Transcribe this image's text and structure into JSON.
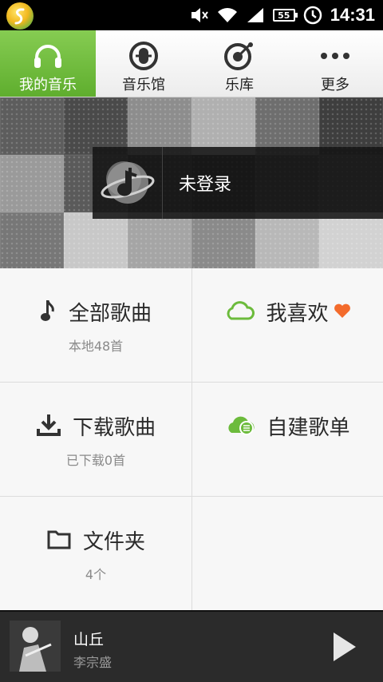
{
  "status_bar": {
    "icons": [
      "app-logo-icon",
      "mute-icon",
      "wifi-icon",
      "signal-icon",
      "battery-icon",
      "alarm-icon"
    ],
    "battery_level": "55",
    "time": "14:31"
  },
  "tabs": [
    {
      "label": "我的音乐",
      "icon": "headphones-icon",
      "active": true
    },
    {
      "label": "音乐馆",
      "icon": "music-hall-icon",
      "active": false
    },
    {
      "label": "乐库",
      "icon": "library-icon",
      "active": false
    },
    {
      "label": "更多",
      "icon": "more-icon",
      "active": false
    }
  ],
  "banner": {
    "login_status": "未登录",
    "avatar_icon": "music-planet-icon"
  },
  "menu": {
    "all_songs": {
      "title": "全部歌曲",
      "sub": "本地48首",
      "icon": "music-note-icon"
    },
    "favorites": {
      "title": "我喜欢",
      "icon": "cloud-icon",
      "badge_icon": "heart-icon"
    },
    "downloads": {
      "title": "下载歌曲",
      "sub": "已下载0首",
      "icon": "download-icon"
    },
    "playlists": {
      "title": "自建歌单",
      "icon": "cloud-list-icon"
    },
    "folders": {
      "title": "文件夹",
      "sub": "4个",
      "icon": "folder-icon"
    }
  },
  "player": {
    "song": "山丘",
    "artist": "李宗盛",
    "play_icon": "play-icon"
  },
  "colors": {
    "accent_green": "#6cbb3c",
    "heart": "#f36b2c"
  }
}
